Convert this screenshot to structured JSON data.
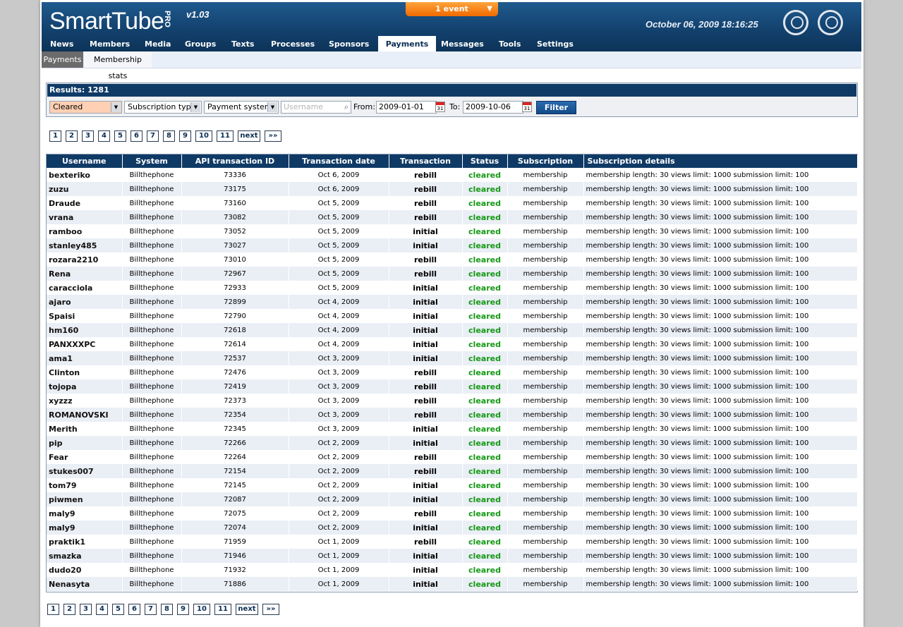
{
  "header": {
    "logo_text": "SmartTube",
    "logo_pro": "PRO",
    "version": "v1.03",
    "event_label": "1 event",
    "datetime": "October 06, 2009 18:16:25"
  },
  "nav": [
    {
      "label": "News"
    },
    {
      "label": "Members"
    },
    {
      "label": "Media"
    },
    {
      "label": "Groups"
    },
    {
      "label": "Texts"
    },
    {
      "label": "Processes"
    },
    {
      "label": "Sponsors"
    },
    {
      "label": "Payments",
      "active": true
    },
    {
      "label": "Messages"
    },
    {
      "label": "Tools"
    },
    {
      "label": "Settings"
    }
  ],
  "subnav": {
    "active": "Payments",
    "item": "Membership stats"
  },
  "filter": {
    "results": "Results: 1281",
    "status_value": "Cleared",
    "subscription_type": "Subscription type",
    "payment_system": "Payment system",
    "username_placeholder": "Username",
    "from_label": "From:",
    "from_value": "2009-01-01",
    "to_label": "To:",
    "to_value": "2009-10-06",
    "filter_button": "Filter",
    "accent_color": "#ffd0b3"
  },
  "pager": [
    "1",
    "2",
    "3",
    "4",
    "5",
    "6",
    "7",
    "8",
    "9",
    "10",
    "11",
    "next",
    "»»"
  ],
  "table": {
    "headers": [
      "Username",
      "System",
      "API transaction ID",
      "Transaction date",
      "Transaction",
      "Status",
      "Subscription",
      "Subscription details"
    ],
    "status_color": "#159915",
    "rows": [
      [
        "bexteriko",
        "Billthephone",
        "73336",
        "Oct 6, 2009",
        "rebill",
        "cleared",
        "membership",
        "membership length: 30 views limit: 1000 submission limit: 100"
      ],
      [
        "zuzu",
        "Billthephone",
        "73175",
        "Oct 6, 2009",
        "rebill",
        "cleared",
        "membership",
        "membership length: 30 views limit: 1000 submission limit: 100"
      ],
      [
        "Draude",
        "Billthephone",
        "73160",
        "Oct 5, 2009",
        "rebill",
        "cleared",
        "membership",
        "membership length: 30 views limit: 1000 submission limit: 100"
      ],
      [
        "vrana",
        "Billthephone",
        "73082",
        "Oct 5, 2009",
        "rebill",
        "cleared",
        "membership",
        "membership length: 30 views limit: 1000 submission limit: 100"
      ],
      [
        "ramboo",
        "Billthephone",
        "73052",
        "Oct 5, 2009",
        "initial",
        "cleared",
        "membership",
        "membership length: 30 views limit: 1000 submission limit: 100"
      ],
      [
        "stanley485",
        "Billthephone",
        "73027",
        "Oct 5, 2009",
        "initial",
        "cleared",
        "membership",
        "membership length: 30 views limit: 1000 submission limit: 100"
      ],
      [
        "rozara2210",
        "Billthephone",
        "73010",
        "Oct 5, 2009",
        "rebill",
        "cleared",
        "membership",
        "membership length: 30 views limit: 1000 submission limit: 100"
      ],
      [
        "Rena",
        "Billthephone",
        "72967",
        "Oct 5, 2009",
        "rebill",
        "cleared",
        "membership",
        "membership length: 30 views limit: 1000 submission limit: 100"
      ],
      [
        "caracciola",
        "Billthephone",
        "72933",
        "Oct 5, 2009",
        "initial",
        "cleared",
        "membership",
        "membership length: 30 views limit: 1000 submission limit: 100"
      ],
      [
        "ajaro",
        "Billthephone",
        "72899",
        "Oct 4, 2009",
        "initial",
        "cleared",
        "membership",
        "membership length: 30 views limit: 1000 submission limit: 100"
      ],
      [
        "Spaisi",
        "Billthephone",
        "72790",
        "Oct 4, 2009",
        "initial",
        "cleared",
        "membership",
        "membership length: 30 views limit: 1000 submission limit: 100"
      ],
      [
        "hm160",
        "Billthephone",
        "72618",
        "Oct 4, 2009",
        "initial",
        "cleared",
        "membership",
        "membership length: 30 views limit: 1000 submission limit: 100"
      ],
      [
        "PANXXXPC",
        "Billthephone",
        "72614",
        "Oct 4, 2009",
        "initial",
        "cleared",
        "membership",
        "membership length: 30 views limit: 1000 submission limit: 100"
      ],
      [
        "ama1",
        "Billthephone",
        "72537",
        "Oct 3, 2009",
        "initial",
        "cleared",
        "membership",
        "membership length: 30 views limit: 1000 submission limit: 100"
      ],
      [
        "Clinton",
        "Billthephone",
        "72476",
        "Oct 3, 2009",
        "rebill",
        "cleared",
        "membership",
        "membership length: 30 views limit: 1000 submission limit: 100"
      ],
      [
        "tojopa",
        "Billthephone",
        "72419",
        "Oct 3, 2009",
        "rebill",
        "cleared",
        "membership",
        "membership length: 30 views limit: 1000 submission limit: 100"
      ],
      [
        "xyzzz",
        "Billthephone",
        "72373",
        "Oct 3, 2009",
        "rebill",
        "cleared",
        "membership",
        "membership length: 30 views limit: 1000 submission limit: 100"
      ],
      [
        "ROMANOVSKI",
        "Billthephone",
        "72354",
        "Oct 3, 2009",
        "rebill",
        "cleared",
        "membership",
        "membership length: 30 views limit: 1000 submission limit: 100"
      ],
      [
        "Merith",
        "Billthephone",
        "72345",
        "Oct 3, 2009",
        "initial",
        "cleared",
        "membership",
        "membership length: 30 views limit: 1000 submission limit: 100"
      ],
      [
        "pip",
        "Billthephone",
        "72266",
        "Oct 2, 2009",
        "initial",
        "cleared",
        "membership",
        "membership length: 30 views limit: 1000 submission limit: 100"
      ],
      [
        "Fear",
        "Billthephone",
        "72264",
        "Oct 2, 2009",
        "rebill",
        "cleared",
        "membership",
        "membership length: 30 views limit: 1000 submission limit: 100"
      ],
      [
        "stukes007",
        "Billthephone",
        "72154",
        "Oct 2, 2009",
        "rebill",
        "cleared",
        "membership",
        "membership length: 30 views limit: 1000 submission limit: 100"
      ],
      [
        "tom79",
        "Billthephone",
        "72145",
        "Oct 2, 2009",
        "initial",
        "cleared",
        "membership",
        "membership length: 30 views limit: 1000 submission limit: 100"
      ],
      [
        "piwmen",
        "Billthephone",
        "72087",
        "Oct 2, 2009",
        "initial",
        "cleared",
        "membership",
        "membership length: 30 views limit: 1000 submission limit: 100"
      ],
      [
        "maly9",
        "Billthephone",
        "72075",
        "Oct 2, 2009",
        "rebill",
        "cleared",
        "membership",
        "membership length: 30 views limit: 1000 submission limit: 100"
      ],
      [
        "maly9",
        "Billthephone",
        "72074",
        "Oct 2, 2009",
        "initial",
        "cleared",
        "membership",
        "membership length: 30 views limit: 1000 submission limit: 100"
      ],
      [
        "praktik1",
        "Billthephone",
        "71959",
        "Oct 1, 2009",
        "rebill",
        "cleared",
        "membership",
        "membership length: 30 views limit: 1000 submission limit: 100"
      ],
      [
        "smazka",
        "Billthephone",
        "71946",
        "Oct 1, 2009",
        "initial",
        "cleared",
        "membership",
        "membership length: 30 views limit: 1000 submission limit: 100"
      ],
      [
        "dudo20",
        "Billthephone",
        "71932",
        "Oct 1, 2009",
        "initial",
        "cleared",
        "membership",
        "membership length: 30 views limit: 1000 submission limit: 100"
      ],
      [
        "Nenasyta",
        "Billthephone",
        "71886",
        "Oct 1, 2009",
        "initial",
        "cleared",
        "membership",
        "membership length: 30 views limit: 1000 submission limit: 100"
      ]
    ]
  }
}
